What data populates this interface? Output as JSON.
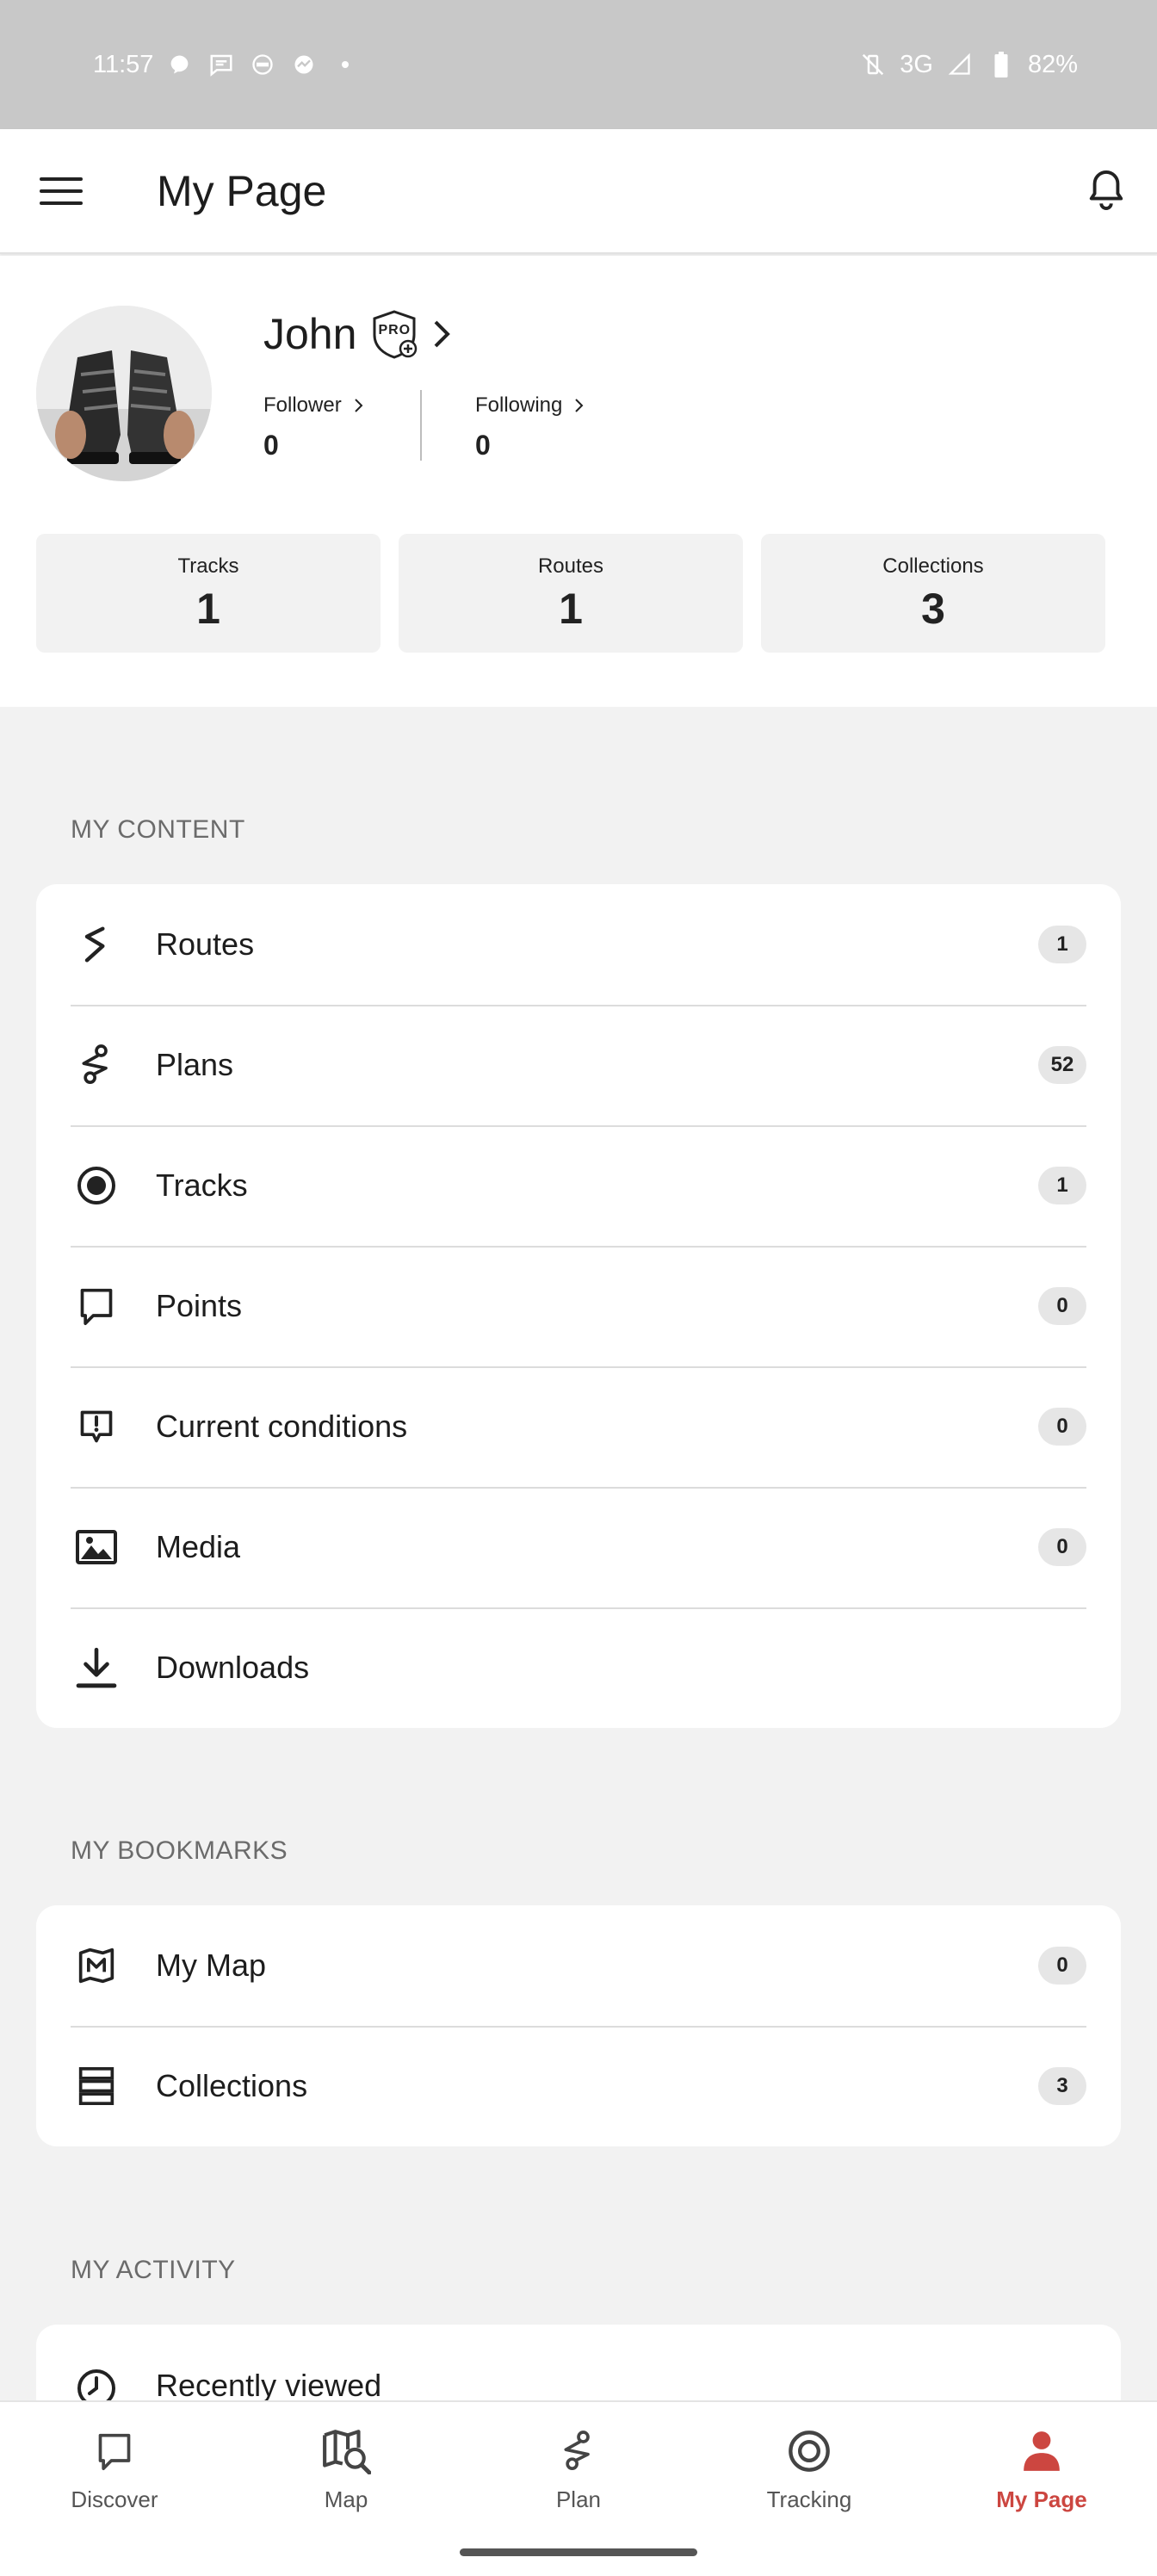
{
  "status_bar": {
    "time": "11:57",
    "network": "3G",
    "battery": "82%"
  },
  "app_bar": {
    "title": "My Page"
  },
  "profile": {
    "name": "John",
    "badge": "PRO",
    "follower_label": "Follower",
    "follower_count": "0",
    "following_label": "Following",
    "following_count": "0",
    "stats": [
      {
        "label": "Tracks",
        "value": "1"
      },
      {
        "label": "Routes",
        "value": "1"
      },
      {
        "label": "Collections",
        "value": "3"
      }
    ]
  },
  "my_content": {
    "heading": "MY CONTENT",
    "items": [
      {
        "label": "Routes",
        "count": "1",
        "icon": "route-icon"
      },
      {
        "label": "Plans",
        "count": "52",
        "icon": "plan-icon"
      },
      {
        "label": "Tracks",
        "count": "1",
        "icon": "track-icon"
      },
      {
        "label": "Points",
        "count": "0",
        "icon": "point-icon"
      },
      {
        "label": "Current conditions",
        "count": "0",
        "icon": "conditions-icon"
      },
      {
        "label": "Media",
        "count": "0",
        "icon": "image-icon"
      },
      {
        "label": "Downloads",
        "count": "",
        "icon": "download-icon"
      }
    ]
  },
  "my_bookmarks": {
    "heading": "MY BOOKMARKS",
    "items": [
      {
        "label": "My Map",
        "count": "0",
        "icon": "map-icon"
      },
      {
        "label": "Collections",
        "count": "3",
        "icon": "collections-icon"
      }
    ]
  },
  "my_activity": {
    "heading": "MY ACTIVITY",
    "items": [
      {
        "label": "Recently viewed",
        "icon": "clock-icon"
      }
    ]
  },
  "bottom_nav": {
    "items": [
      {
        "label": "Discover",
        "icon": "discover-icon"
      },
      {
        "label": "Map",
        "icon": "map-search-icon"
      },
      {
        "label": "Plan",
        "icon": "plan-icon"
      },
      {
        "label": "Tracking",
        "icon": "tracking-icon"
      },
      {
        "label": "My Page",
        "icon": "person-icon"
      }
    ],
    "active": "My Page"
  },
  "colors": {
    "accent": "#cc4640",
    "status_bar_bg": "#c8c8c8",
    "page_bg": "#f2f2f2"
  }
}
